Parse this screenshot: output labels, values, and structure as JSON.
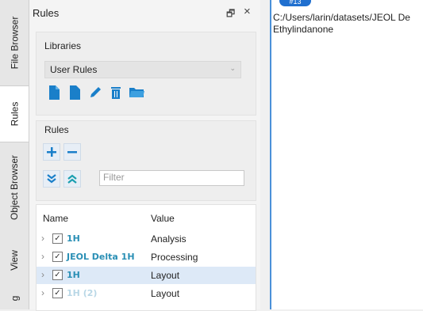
{
  "side_tabs": [
    "File Browser",
    "Rules",
    "Object Browser",
    "View",
    "g"
  ],
  "panel": {
    "title": "Rules",
    "float_glyph": "🗗",
    "close_glyph": "×"
  },
  "libraries": {
    "title": "Libraries",
    "selected": "User Rules"
  },
  "rules": {
    "title": "Rules",
    "filter_placeholder": "Filter"
  },
  "table": {
    "headers": [
      "Name",
      "Value"
    ],
    "rows": [
      {
        "name": "1H",
        "value": "Analysis",
        "checked": true,
        "faded": false,
        "selected": false
      },
      {
        "name": "JEOL Delta 1H",
        "value": "Processing",
        "checked": true,
        "faded": false,
        "selected": false
      },
      {
        "name": "1H",
        "value": "Layout",
        "checked": true,
        "faded": false,
        "selected": true
      },
      {
        "name": "1H (2)",
        "value": "Layout",
        "checked": true,
        "faded": true,
        "selected": false
      }
    ]
  },
  "document": {
    "path": "C:/Users/larin/datasets/JEOL De",
    "name": "Ethylindanone",
    "badge": "#13"
  },
  "colors": {
    "accent": "#1f6fcf",
    "item_text": "#2a8fb5",
    "selection": "#dde9f7"
  }
}
